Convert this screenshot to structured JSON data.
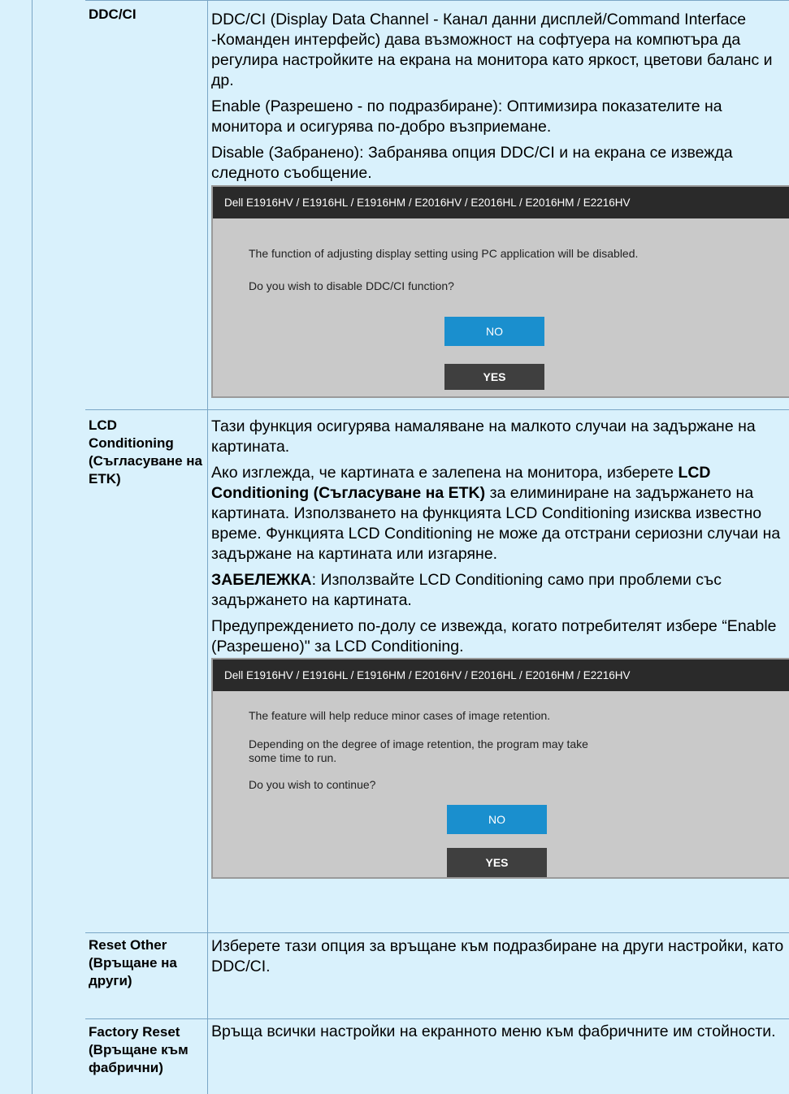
{
  "rows": [
    {
      "label": "DDC/CI",
      "paragraphs": [
        "DDC/CI (Display Data Channel - Канал данни дисплей/Command Interface -Команден интерфейс) дава възможност на софтуера на компютъра да регулира настройките на екрана на монитора като яркост, цветови баланс и др.",
        "Enable (Разрешено - по подразбиране): Оптимизира показателите на монитора и осигурява по-добро възприемане.",
        "Disable (Забранено): Забранява опция DDC/CI и на екрана се извежда следното съобщение."
      ],
      "dialog": {
        "title": "Dell E1916HV / E1916HL / E1916HM / E2016HV / E2016HL / E2016HM / E2216HV",
        "lines": [
          "The function of adjusting display setting using PC application will be disabled.",
          "Do you wish to disable DDC/CI function?"
        ],
        "no_label": "NO",
        "yes_label": "YES"
      }
    },
    {
      "label": "LCD Conditioning (Съгласуване на ETK)",
      "paragraphs": [
        "Тази функция осигурява намаляване на малкото случаи на задържане на картината.",
        "Ако изглежда, че картината е залепена на монитора, изберете",
        "LCD Conditioning (Съгласуване на ETK)",
        "за елиминиране на задържането на картината. Използването на функцията LCD Conditioning изисква известно време. Функцията LCD Conditioning не може да отстрани сериозни случаи на задържане на картината или изгаряне.",
        "ЗАБЕЛЕЖКА",
        ": Използвайте LCD Conditioning само при проблеми със задържането на картината.",
        "Предупреждението по-долу се извежда, когато потребителят избере “Enable (Разрешено)\" за LCD Conditioning."
      ],
      "dialog": {
        "title": "Dell E1916HV / E1916HL / E1916HM / E2016HV / E2016HL / E2016HM / E2216HV",
        "lines": [
          "The feature will help reduce minor cases of image retention.",
          "Depending on the degree of image retention, the program may take",
          "some time to run.",
          "Do you wish to continue?"
        ],
        "no_label": "NO",
        "yes_label": "YES"
      }
    },
    {
      "label": "Reset Other (Връщане на други)",
      "paragraphs": [
        "Изберете тази опция за връщане към подразбиране на други настройки, като DDC/CI."
      ]
    },
    {
      "label": "Factory Reset (Връщане към фабрични)",
      "paragraphs": [
        "Връща всички настройки на екранното меню към фабричните им стойности."
      ]
    }
  ],
  "colors": {
    "cell_bg": "#d9f1fc",
    "border": "#7aa6c6",
    "dialog_bg": "#c9c9c9",
    "dialog_title_bg": "#2a2a2a",
    "no_button": "#1a8fce",
    "yes_button": "#3f3f3f"
  }
}
